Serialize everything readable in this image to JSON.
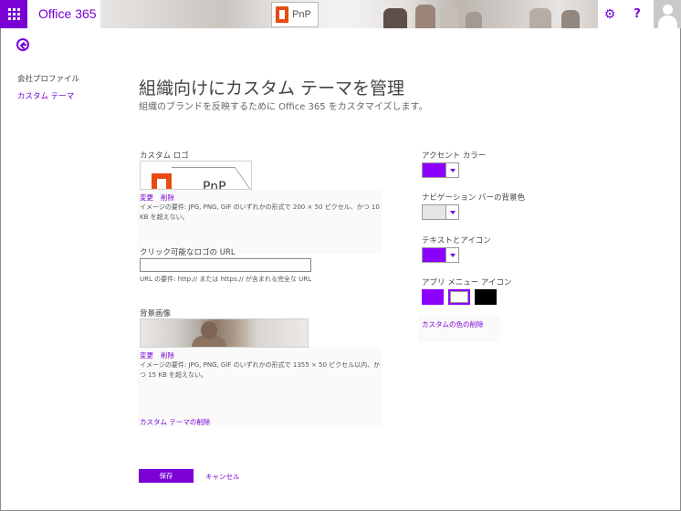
{
  "suite_bar": {
    "app_name": "Office 365",
    "banner_logo_text": "PnP",
    "icons": [
      "app-launcher-icon",
      "gear-icon",
      "help-icon",
      "user-avatar-icon"
    ],
    "help_label": "?",
    "settings_glyph": "⚙"
  },
  "nav": {
    "items": [
      {
        "label": "会社プロファイル"
      },
      {
        "label": "カスタム テーマ"
      }
    ]
  },
  "page": {
    "title": "組織向けにカスタム テーマを管理",
    "subtitle": "組織のブランドを反映するために Office 365 をカスタマイズします。"
  },
  "custom_logo": {
    "label": "カスタム ロゴ",
    "preview_text": "PnP",
    "change_label": "変更",
    "delete_label": "削除",
    "hint": "イメージの要件: JPG, PNG, GIF のいずれかの形式で 200 × 50 ピクセル、かつ 10 KB を超えない。"
  },
  "clickable_logo_url": {
    "label": "クリック可能なロゴの URL",
    "value": "",
    "hint": "URL の要件: http:// または https:// が含まれる完全な URL"
  },
  "background_image": {
    "label": "背景画像",
    "change_label": "変更",
    "delete_label": "削除",
    "hint": "イメージの要件: JPG, PNG, GIF のいずれかの形式で 1355 × 50 ピクセル以内、かつ 15 KB を超えない。",
    "remove_theme_label": "カスタム テーマの削除"
  },
  "colors": {
    "accent": {
      "label": "アクセント カラー",
      "value": "#8c00ff"
    },
    "nav_bar_bg": {
      "label": "ナビゲーション バーの背景色",
      "value": "#e6e6e8"
    },
    "text_icons": {
      "label": "テキストとアイコン",
      "value": "#8c00ff"
    },
    "app_menu_icon": {
      "label": "アプリ メニュー アイコン",
      "options": [
        "#8c00ff",
        "#ffffff",
        "#000000"
      ],
      "selected_index": 1
    },
    "remove_custom_colors_label": "カスタムの色の削除"
  },
  "actions": {
    "save_label": "保存",
    "cancel_label": "キャンセル"
  }
}
